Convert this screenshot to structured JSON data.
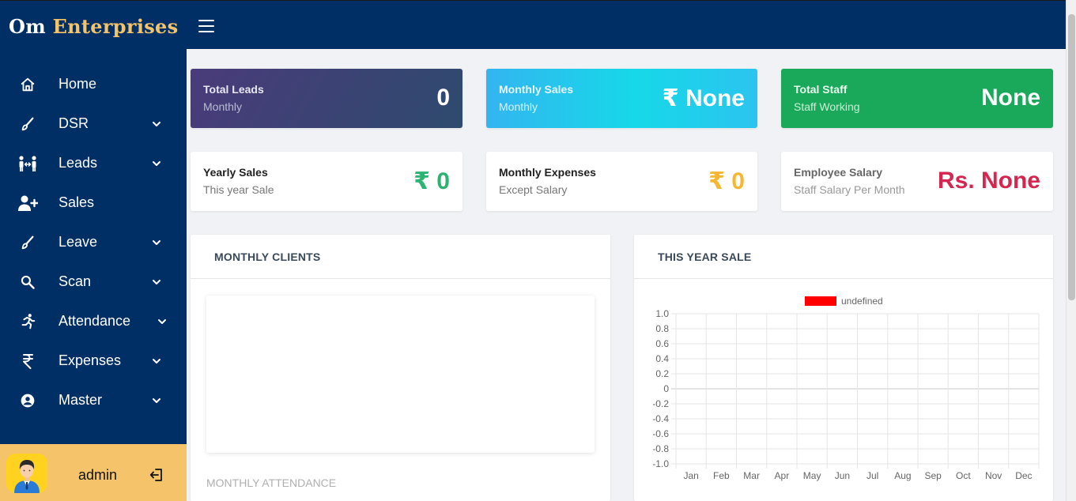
{
  "brand": {
    "part1": "Om",
    "part2": "Enterprises"
  },
  "nav": {
    "home": "Home",
    "dsr": "DSR",
    "leads": "Leads",
    "sales": "Sales",
    "leave": "Leave",
    "scan": "Scan",
    "attendance": "Attendance",
    "expenses": "Expenses",
    "master": "Master"
  },
  "user": {
    "name": "admin"
  },
  "cards": {
    "total_leads": {
      "title": "Total Leads",
      "subtitle": "Monthly",
      "value": "0"
    },
    "monthly_sales": {
      "title": "Monthly Sales",
      "subtitle": "Monthly",
      "value": "₹ None"
    },
    "total_staff": {
      "title": "Total Staff",
      "subtitle": "Staff Working",
      "value": "None"
    },
    "yearly_sales": {
      "title": "Yearly Sales",
      "subtitle": "This year Sale",
      "value": "₹ 0"
    },
    "monthly_expenses": {
      "title": "Monthly Expenses",
      "subtitle": "Except Salary",
      "value": "₹ 0"
    },
    "employee_salary": {
      "title": "Employee Salary",
      "subtitle": "Staff Salary Per Month",
      "value": "Rs. None"
    }
  },
  "colors": {
    "navy": "#002f66",
    "gold": "#f4c36a",
    "green_value": "#2db371",
    "yellow_value": "#f5b731",
    "red_value": "#d6264f",
    "legend_red": "#ff0000"
  },
  "panels": {
    "monthly_clients": "MONTHLY CLIENTS",
    "monthly_attendance": "MONTHLY ATTENDANCE",
    "this_year_sale": "THIS YEAR SALE"
  },
  "chart_data": {
    "type": "line",
    "title": "",
    "xlabel": "",
    "ylabel": "",
    "categories": [
      "Jan",
      "Feb",
      "Mar",
      "Apr",
      "May",
      "Jun",
      "Jul",
      "Aug",
      "Sep",
      "Oct",
      "Nov",
      "Dec"
    ],
    "series": [
      {
        "name": "undefined",
        "color": "#ff0000",
        "values": []
      }
    ],
    "ylim": [
      -1.0,
      1.0
    ],
    "yticks": [
      "1.0",
      "0.8",
      "0.6",
      "0.4",
      "0.2",
      "0",
      "-0.2",
      "-0.4",
      "-0.6",
      "-0.8",
      "-1.0"
    ],
    "grid": true,
    "legend": "top-center"
  }
}
